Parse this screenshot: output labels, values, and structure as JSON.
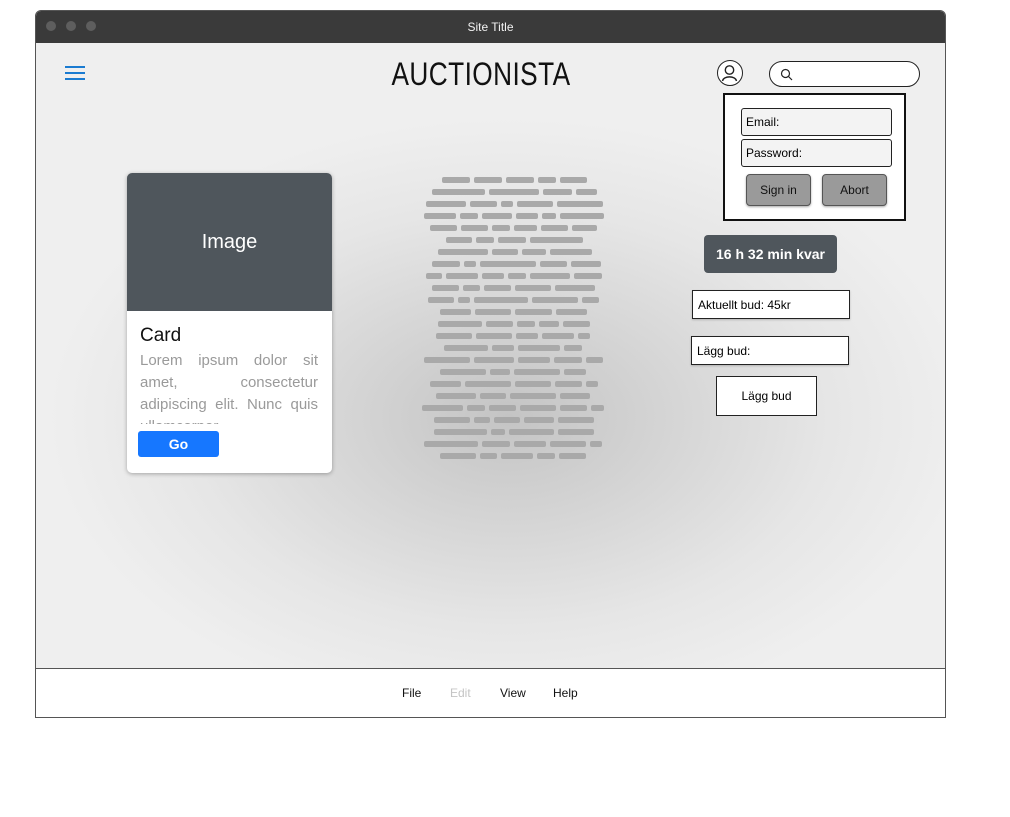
{
  "window": {
    "title": "Site Title"
  },
  "header": {
    "brand": "AUCTIONISTA",
    "search": {
      "value": "",
      "placeholder": ""
    }
  },
  "login": {
    "email_label": "Email:",
    "password_label": "Password:",
    "sign_in_label": "Sign in",
    "abort_label": "Abort"
  },
  "auction": {
    "time_left": "16 h 32 min kvar",
    "current_bid": "Aktuellt bud: 45kr",
    "bid_input_label": "Lägg bud:",
    "place_bid_label": "Lägg bud"
  },
  "card": {
    "image_label": "Image",
    "title": "Card",
    "text": "Lorem ipsum dolor sit amet, consectetur adipiscing elit. Nunc quis ullamcorper",
    "button_label": "Go"
  },
  "menu": {
    "items": [
      {
        "label": "File",
        "enabled": true
      },
      {
        "label": "Edit",
        "enabled": false
      },
      {
        "label": "View",
        "enabled": true
      },
      {
        "label": "Help",
        "enabled": true
      }
    ]
  },
  "icons": {
    "hamburger": "menu-icon",
    "user": "user-icon",
    "search": "search-icon",
    "text_placeholder": "text-placeholder-block"
  },
  "colors": {
    "titlebar": "#3a3a3a",
    "accent": "#1a7bd1",
    "primary_button": "#1677ff",
    "dark_panel": "#4f565c",
    "dash": "#a9a9a9"
  }
}
